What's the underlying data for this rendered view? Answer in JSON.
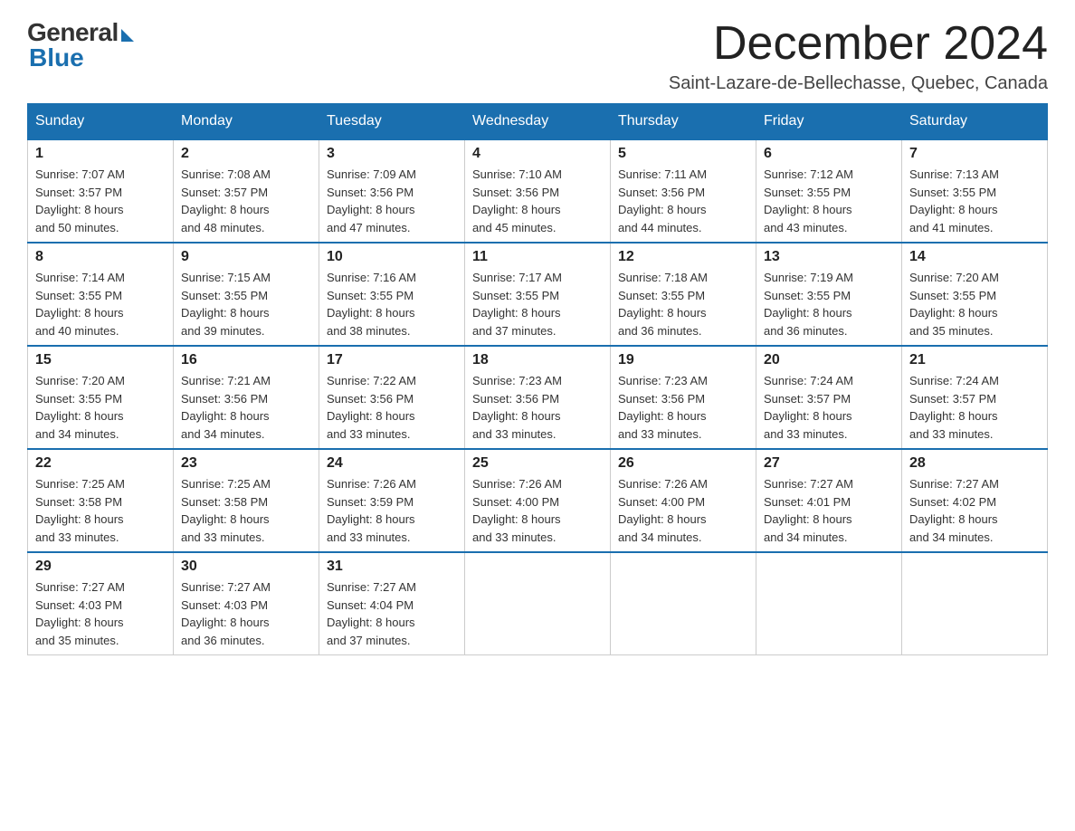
{
  "logo": {
    "general": "General",
    "blue": "Blue"
  },
  "header": {
    "month_title": "December 2024",
    "location": "Saint-Lazare-de-Bellechasse, Quebec, Canada"
  },
  "days_of_week": [
    "Sunday",
    "Monday",
    "Tuesday",
    "Wednesday",
    "Thursday",
    "Friday",
    "Saturday"
  ],
  "weeks": [
    [
      {
        "day": "1",
        "sunrise": "7:07 AM",
        "sunset": "3:57 PM",
        "daylight": "8 hours and 50 minutes."
      },
      {
        "day": "2",
        "sunrise": "7:08 AM",
        "sunset": "3:57 PM",
        "daylight": "8 hours and 48 minutes."
      },
      {
        "day": "3",
        "sunrise": "7:09 AM",
        "sunset": "3:56 PM",
        "daylight": "8 hours and 47 minutes."
      },
      {
        "day": "4",
        "sunrise": "7:10 AM",
        "sunset": "3:56 PM",
        "daylight": "8 hours and 45 minutes."
      },
      {
        "day": "5",
        "sunrise": "7:11 AM",
        "sunset": "3:56 PM",
        "daylight": "8 hours and 44 minutes."
      },
      {
        "day": "6",
        "sunrise": "7:12 AM",
        "sunset": "3:55 PM",
        "daylight": "8 hours and 43 minutes."
      },
      {
        "day": "7",
        "sunrise": "7:13 AM",
        "sunset": "3:55 PM",
        "daylight": "8 hours and 41 minutes."
      }
    ],
    [
      {
        "day": "8",
        "sunrise": "7:14 AM",
        "sunset": "3:55 PM",
        "daylight": "8 hours and 40 minutes."
      },
      {
        "day": "9",
        "sunrise": "7:15 AM",
        "sunset": "3:55 PM",
        "daylight": "8 hours and 39 minutes."
      },
      {
        "day": "10",
        "sunrise": "7:16 AM",
        "sunset": "3:55 PM",
        "daylight": "8 hours and 38 minutes."
      },
      {
        "day": "11",
        "sunrise": "7:17 AM",
        "sunset": "3:55 PM",
        "daylight": "8 hours and 37 minutes."
      },
      {
        "day": "12",
        "sunrise": "7:18 AM",
        "sunset": "3:55 PM",
        "daylight": "8 hours and 36 minutes."
      },
      {
        "day": "13",
        "sunrise": "7:19 AM",
        "sunset": "3:55 PM",
        "daylight": "8 hours and 36 minutes."
      },
      {
        "day": "14",
        "sunrise": "7:20 AM",
        "sunset": "3:55 PM",
        "daylight": "8 hours and 35 minutes."
      }
    ],
    [
      {
        "day": "15",
        "sunrise": "7:20 AM",
        "sunset": "3:55 PM",
        "daylight": "8 hours and 34 minutes."
      },
      {
        "day": "16",
        "sunrise": "7:21 AM",
        "sunset": "3:56 PM",
        "daylight": "8 hours and 34 minutes."
      },
      {
        "day": "17",
        "sunrise": "7:22 AM",
        "sunset": "3:56 PM",
        "daylight": "8 hours and 33 minutes."
      },
      {
        "day": "18",
        "sunrise": "7:23 AM",
        "sunset": "3:56 PM",
        "daylight": "8 hours and 33 minutes."
      },
      {
        "day": "19",
        "sunrise": "7:23 AM",
        "sunset": "3:56 PM",
        "daylight": "8 hours and 33 minutes."
      },
      {
        "day": "20",
        "sunrise": "7:24 AM",
        "sunset": "3:57 PM",
        "daylight": "8 hours and 33 minutes."
      },
      {
        "day": "21",
        "sunrise": "7:24 AM",
        "sunset": "3:57 PM",
        "daylight": "8 hours and 33 minutes."
      }
    ],
    [
      {
        "day": "22",
        "sunrise": "7:25 AM",
        "sunset": "3:58 PM",
        "daylight": "8 hours and 33 minutes."
      },
      {
        "day": "23",
        "sunrise": "7:25 AM",
        "sunset": "3:58 PM",
        "daylight": "8 hours and 33 minutes."
      },
      {
        "day": "24",
        "sunrise": "7:26 AM",
        "sunset": "3:59 PM",
        "daylight": "8 hours and 33 minutes."
      },
      {
        "day": "25",
        "sunrise": "7:26 AM",
        "sunset": "4:00 PM",
        "daylight": "8 hours and 33 minutes."
      },
      {
        "day": "26",
        "sunrise": "7:26 AM",
        "sunset": "4:00 PM",
        "daylight": "8 hours and 34 minutes."
      },
      {
        "day": "27",
        "sunrise": "7:27 AM",
        "sunset": "4:01 PM",
        "daylight": "8 hours and 34 minutes."
      },
      {
        "day": "28",
        "sunrise": "7:27 AM",
        "sunset": "4:02 PM",
        "daylight": "8 hours and 34 minutes."
      }
    ],
    [
      {
        "day": "29",
        "sunrise": "7:27 AM",
        "sunset": "4:03 PM",
        "daylight": "8 hours and 35 minutes."
      },
      {
        "day": "30",
        "sunrise": "7:27 AM",
        "sunset": "4:03 PM",
        "daylight": "8 hours and 36 minutes."
      },
      {
        "day": "31",
        "sunrise": "7:27 AM",
        "sunset": "4:04 PM",
        "daylight": "8 hours and 37 minutes."
      },
      null,
      null,
      null,
      null
    ]
  ],
  "labels": {
    "sunrise": "Sunrise:",
    "sunset": "Sunset:",
    "daylight": "Daylight:"
  }
}
